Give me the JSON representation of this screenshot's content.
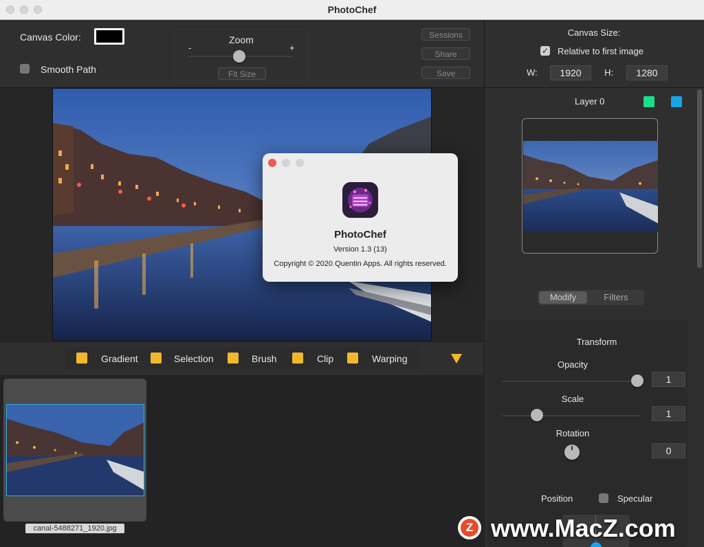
{
  "window": {
    "title": "PhotoChef"
  },
  "toolbar": {
    "canvas_color_label": "Canvas Color:",
    "canvas_color_value": "#000000",
    "smooth_path_label": "Smooth Path",
    "zoom_label": "Zoom",
    "zoom_minus": "-",
    "zoom_plus": "+",
    "fit_size_label": "Fit Size",
    "sessions_label": "Sessions",
    "share_label": "Share",
    "save_label": "Save"
  },
  "canvas_size": {
    "title": "Canvas Size:",
    "relative_label": "Relative to first image",
    "relative_checked": true,
    "w_label": "W:",
    "w_value": "1920",
    "h_label": "H:",
    "h_value": "1280"
  },
  "layer": {
    "name": "Layer 0",
    "color_a": "#18e08a",
    "color_b": "#1aa3e8"
  },
  "panel_tabs": {
    "modify": "Modify",
    "filters": "Filters",
    "selected": "Modify"
  },
  "transform": {
    "title": "Transform",
    "opacity_label": "Opacity",
    "opacity_value": "1",
    "scale_label": "Scale",
    "scale_value": "1",
    "rotation_label": "Rotation",
    "rotation_value": "0",
    "position_label": "Position",
    "specular_label": "Specular"
  },
  "tools": [
    {
      "label": "Gradient"
    },
    {
      "label": "Selection"
    },
    {
      "label": "Brush"
    },
    {
      "label": "Clip"
    },
    {
      "label": "Warping"
    }
  ],
  "tool_accent": "#f2b72c",
  "files": [
    {
      "name": "canal-5488271_1920.jpg"
    }
  ],
  "about_dialog": {
    "app_name": "PhotoChef",
    "version": "Version 1.3 (13)",
    "copyright": "Copyright © 2020 Quentin Apps. All rights reserved."
  },
  "watermark": {
    "text": "www.MacZ.com",
    "badge": "Z"
  }
}
